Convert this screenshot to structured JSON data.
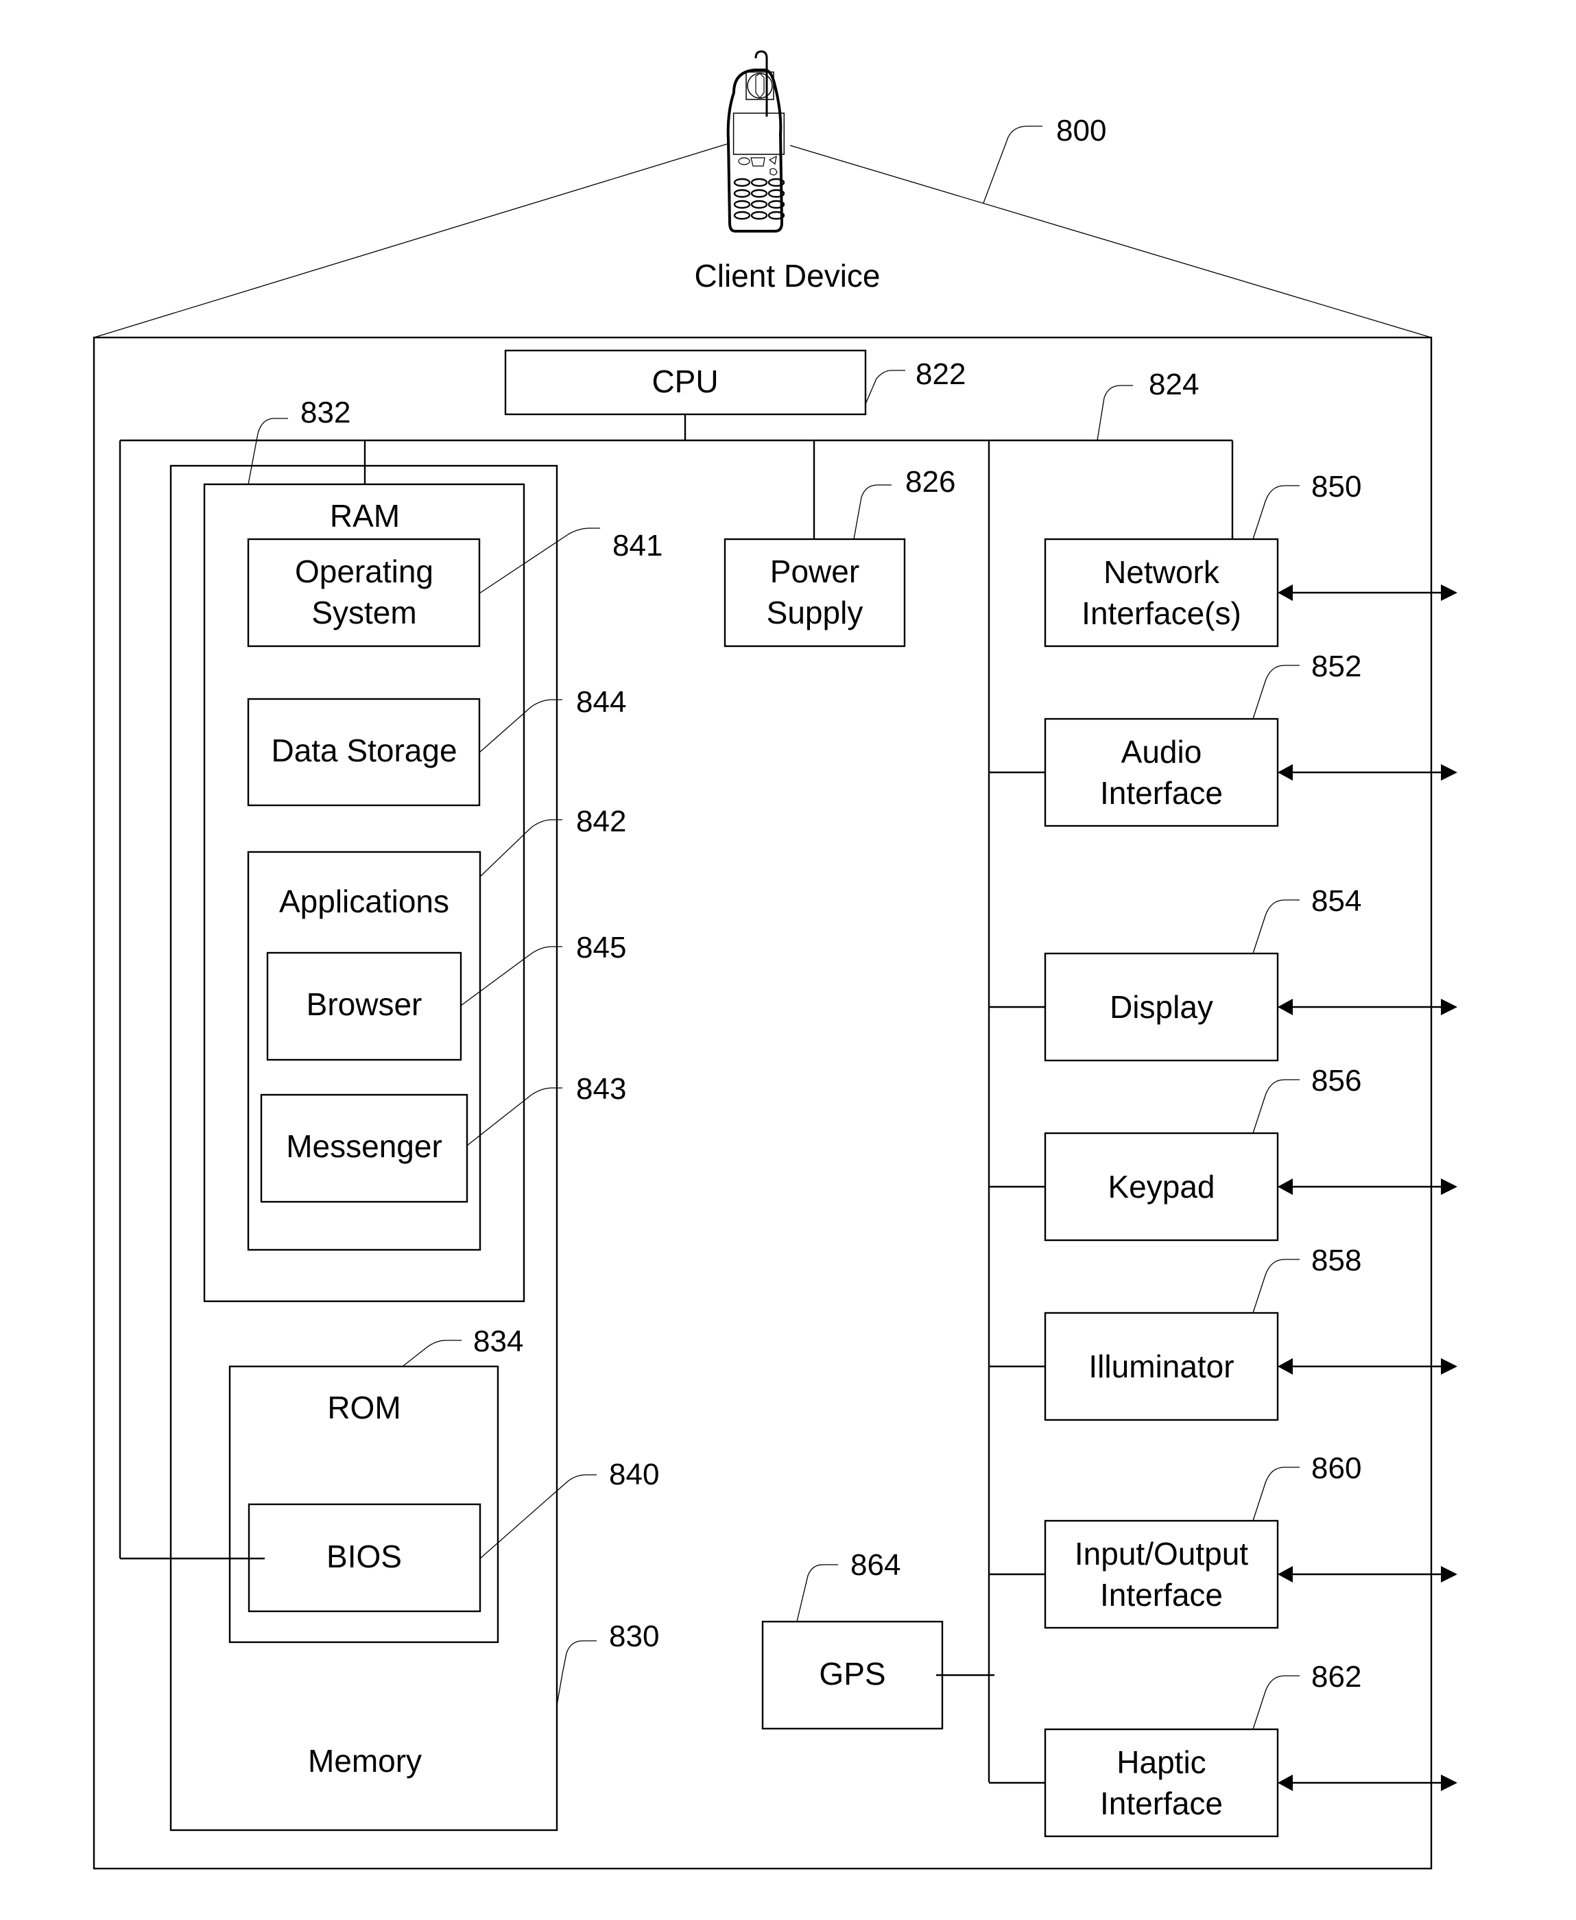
{
  "figure": {
    "title": "Client Device",
    "ref": "800"
  },
  "cpu": {
    "label": "CPU",
    "ref": "822"
  },
  "bus": {
    "ref": "824"
  },
  "power_supply": {
    "label_lines": [
      "Power",
      "Supply"
    ],
    "ref": "826"
  },
  "memory": {
    "label": "Memory",
    "ref": "830",
    "ram": {
      "label": "RAM",
      "ref": "832",
      "operating_system": {
        "label_lines": [
          "Operating",
          "System"
        ],
        "ref": "841"
      },
      "data_storage": {
        "label": "Data Storage",
        "ref": "844"
      },
      "applications": {
        "label": "Applications",
        "ref": "842",
        "browser": {
          "label": "Browser",
          "ref": "845"
        },
        "messenger": {
          "label": "Messenger",
          "ref": "843"
        }
      }
    },
    "rom": {
      "label": "ROM",
      "ref": "834",
      "bios": {
        "label": "BIOS",
        "ref": "840"
      }
    }
  },
  "gps": {
    "label": "GPS",
    "ref": "864"
  },
  "peripherals": [
    {
      "id": "network-interface",
      "label_lines": [
        "Network",
        "Interface(s)"
      ],
      "ref": "850"
    },
    {
      "id": "audio-interface",
      "label_lines": [
        "Audio",
        "Interface"
      ],
      "ref": "852"
    },
    {
      "id": "display",
      "label_lines": [
        "Display"
      ],
      "ref": "854"
    },
    {
      "id": "keypad",
      "label_lines": [
        "Keypad"
      ],
      "ref": "856"
    },
    {
      "id": "illuminator",
      "label_lines": [
        "Illuminator"
      ],
      "ref": "858"
    },
    {
      "id": "input-output-interface",
      "label_lines": [
        "Input/Output",
        "Interface"
      ],
      "ref": "860"
    },
    {
      "id": "haptic-interface",
      "label_lines": [
        "Haptic",
        "Interface"
      ],
      "ref": "862"
    }
  ],
  "icons": {
    "device": "mobile-phone-icon"
  }
}
